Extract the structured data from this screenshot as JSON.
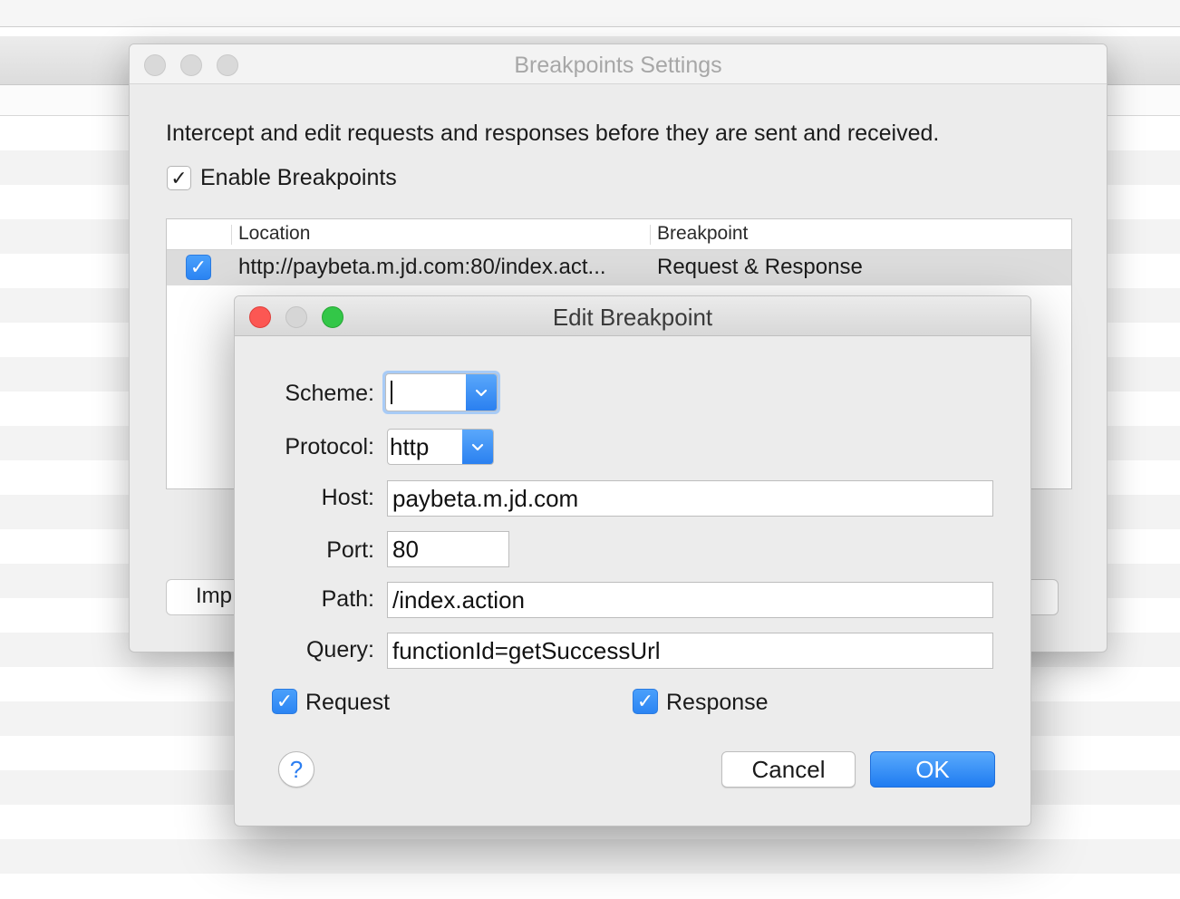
{
  "settings_window": {
    "title": "Breakpoints Settings",
    "description": "Intercept and edit requests and responses before they are sent and received.",
    "enable_label": "Enable Breakpoints",
    "table": {
      "columns": [
        "Location",
        "Breakpoint"
      ],
      "rows": [
        {
          "location": "http://paybeta.m.jd.com:80/index.act...",
          "breakpoint": "Request & Response",
          "enabled": true
        }
      ]
    },
    "import_button_label": "Imp"
  },
  "edit_dialog": {
    "title": "Edit Breakpoint",
    "scheme": {
      "label": "Scheme:",
      "value": ""
    },
    "protocol": {
      "label": "Protocol:",
      "value": "http"
    },
    "host": {
      "label": "Host:",
      "value": "paybeta.m.jd.com"
    },
    "port": {
      "label": "Port:",
      "value": "80"
    },
    "path": {
      "label": "Path:",
      "value": "/index.action"
    },
    "query": {
      "label": "Query:",
      "value": "functionId=getSuccessUrl"
    },
    "request_label": "Request",
    "response_label": "Response",
    "help_label": "?",
    "cancel_label": "Cancel",
    "ok_label": "OK"
  },
  "colors": {
    "accent": "#2b84f3",
    "close": "#fc5753",
    "zoom": "#33c748"
  },
  "icons": {
    "checkmark": "check-icon",
    "dropdown": "chevron-down-icon"
  }
}
